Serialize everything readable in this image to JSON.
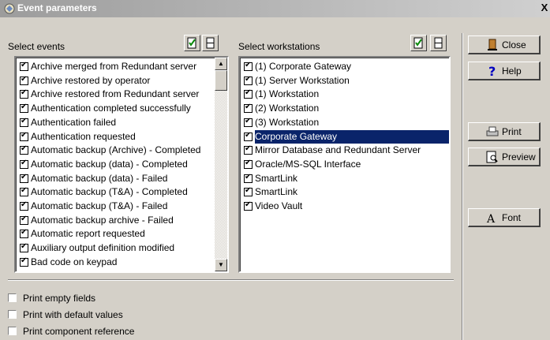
{
  "window": {
    "title": "Event parameters",
    "close_glyph": "X"
  },
  "events": {
    "label": "Select events",
    "items": [
      "Archive merged from Redundant server",
      "Archive restored by operator",
      "Archive restored from  Redundant server",
      "Authentication completed successfully",
      "Authentication failed",
      "Authentication requested",
      "Automatic backup (Archive) - Completed",
      "Automatic backup (data) - Completed",
      "Automatic backup (data) - Failed",
      "Automatic backup (T&A) - Completed",
      "Automatic backup (T&A) - Failed",
      "Automatic backup archive  - Failed",
      "Automatic report requested",
      "Auxiliary output definition modified",
      "Bad code on keypad"
    ]
  },
  "workstations": {
    "label": "Select workstations",
    "items": [
      "(1)  Corporate Gateway",
      "(1)  Server Workstation",
      "(1)  Workstation",
      "(2)  Workstation",
      "(3)  Workstation",
      "Corporate Gateway",
      "Mirror Database and Redundant Server",
      "Oracle/MS-SQL Interface",
      "SmartLink",
      "SmartLink",
      "Video Vault"
    ],
    "selected_index": 5
  },
  "buttons": {
    "close": "Close",
    "help": "Help",
    "print": "Print",
    "preview": "Preview",
    "font": "Font"
  },
  "options": [
    "Print empty fields",
    "Print with default values",
    "Print component reference"
  ],
  "colors": {
    "selection": "#0a246a",
    "face": "#d4d0c8"
  }
}
